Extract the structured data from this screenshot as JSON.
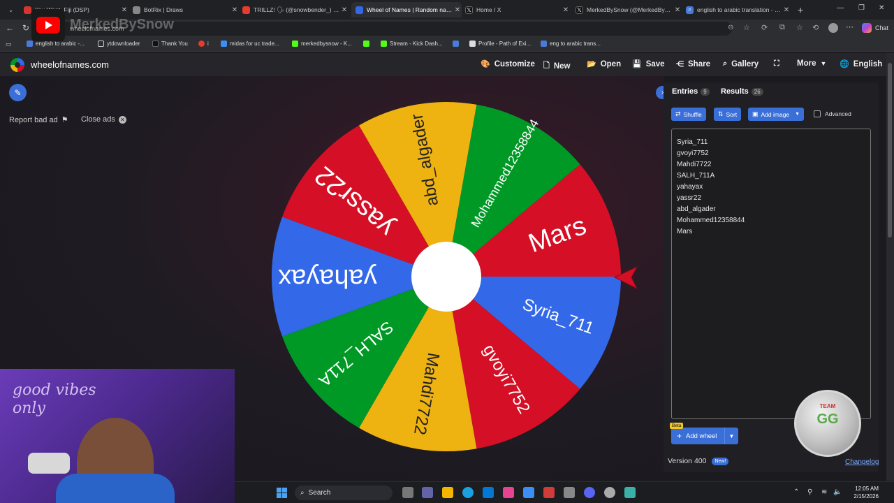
{
  "browser": {
    "tabs": [
      {
        "title": "You Want- Fiji (DSP)",
        "color": "#d6342c"
      },
      {
        "title": "BotRix | Draws",
        "color": "#888888"
      },
      {
        "title": "TRILLZ! 🗣 (@snowbender_) • B",
        "color": "#e63b2e"
      },
      {
        "title": "Wheel of Names | Random name",
        "color": "#3369e8"
      },
      {
        "title": "Home / X",
        "color": "#111111"
      },
      {
        "title": "MerkedBySnow (@MerkedBySno",
        "color": "#111111"
      },
      {
        "title": "english to arabic translation - Sea",
        "color": "#4a7bd8"
      }
    ],
    "url": "wheelofnames.com",
    "bookmarks": [
      "english to arabic -...",
      "ytdownloader",
      "Thank You",
      "i",
      "midas for uc trade...",
      "merkedbysnow - K...",
      "K",
      "Stream - Kick Dash...",
      "Q",
      "Profile - Path of Exi...",
      "eng to arabic trans..."
    ],
    "copilot_label": "Chat"
  },
  "overlay": {
    "channel_name": "MerkedBySnow",
    "cam_text": "good vibes only"
  },
  "site": {
    "name": "wheelofnames.com",
    "nav": {
      "customize": "Customize",
      "new": "New",
      "open": "Open",
      "save": "Save",
      "share": "Share",
      "gallery": "Gallery",
      "more": "More",
      "language": "English"
    },
    "ads": {
      "report": "Report bad ad",
      "close": "Close ads"
    }
  },
  "wheel": {
    "segments": [
      {
        "name": "Syria_711",
        "color": "#3369e8"
      },
      {
        "name": "gvoyi7752",
        "color": "#d50f25"
      },
      {
        "name": "Mahdi7722",
        "color": "#eeb211"
      },
      {
        "name": "SALH_711A",
        "color": "#009925"
      },
      {
        "name": "yahayax",
        "color": "#3369e8"
      },
      {
        "name": "yassr22",
        "color": "#d50f25"
      },
      {
        "name": "abd_algader",
        "color": "#eeb211"
      },
      {
        "name": "Mohammed12358844",
        "color": "#009925"
      },
      {
        "name": "Mars",
        "color": "#d50f25"
      }
    ],
    "pointer_color": "#d50f25"
  },
  "panel": {
    "entries_tab": "Entries",
    "entries_count": "9",
    "results_tab": "Results",
    "results_count": "26",
    "shuffle": "Shuffle",
    "sort": "Sort",
    "add_image": "Add image",
    "advanced": "Advanced",
    "entries": [
      "Syria_711",
      "gvoyi7752",
      "Mahdi7722",
      "SALH_711A",
      "yahayax",
      "yassr22",
      "abd_algader",
      "Mohammed12358844",
      "Mars"
    ],
    "beta": "Beta",
    "add_wheel": "Add wheel",
    "version": "Version 400",
    "new_badge": "New!",
    "changelog": "Changelog",
    "sticker_top": "TEAM",
    "sticker_main": "GG"
  },
  "taskbar": {
    "search": "Search",
    "time": "12:05 AM",
    "date": "2/15/2026"
  }
}
